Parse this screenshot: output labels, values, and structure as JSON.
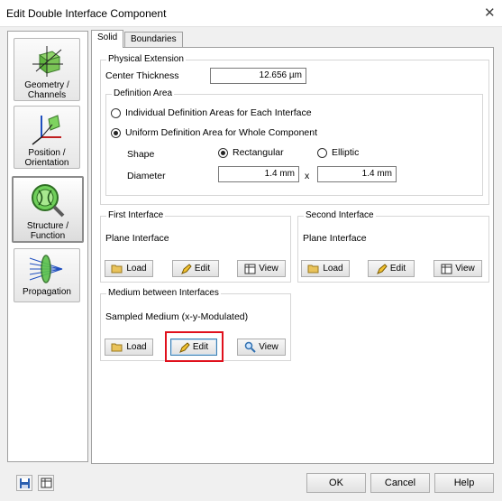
{
  "window": {
    "title": "Edit Double Interface Component",
    "close_glyph": "✕"
  },
  "sidebar": {
    "items": [
      {
        "label": "Geometry / Channels",
        "icon": "geometry-cube-icon"
      },
      {
        "label": "Position / Orientation",
        "icon": "axes-icon"
      },
      {
        "label": "Structure / Function",
        "icon": "lens-magnifier-icon",
        "selected": true
      },
      {
        "label": "Propagation",
        "icon": "propagation-lens-icon"
      }
    ]
  },
  "tabs": [
    {
      "label": "Solid",
      "active": true
    },
    {
      "label": "Boundaries",
      "active": false
    }
  ],
  "physical_extension": {
    "group_label": "Physical Extension",
    "center_thickness_label": "Center Thickness",
    "center_thickness_value": "12.656 µm",
    "definition_area": {
      "group_label": "Definition Area",
      "option_individual": "Individual Definition Areas for Each Interface",
      "option_uniform": "Uniform Definition Area for Whole Component",
      "selected": "uniform",
      "shape_label": "Shape",
      "shape_rect": "Rectangular",
      "shape_elliptic": "Elliptic",
      "shape_selected": "rectangular",
      "diameter_label": "Diameter",
      "diameter_x": "1.4 mm",
      "times": "x",
      "diameter_y": "1.4 mm"
    }
  },
  "first_interface": {
    "group_label": "First Interface",
    "type": "Plane Interface",
    "load": "Load",
    "edit": "Edit",
    "view": "View"
  },
  "second_interface": {
    "group_label": "Second Interface",
    "type": "Plane Interface",
    "load": "Load",
    "edit": "Edit",
    "view": "View"
  },
  "medium": {
    "group_label": "Medium between Interfaces",
    "type": "Sampled Medium (x-y-Modulated)",
    "load": "Load",
    "edit": "Edit",
    "view": "View"
  },
  "footer": {
    "ok": "OK",
    "cancel": "Cancel",
    "help": "Help"
  },
  "colors": {
    "highlight": "#e0101c",
    "accent_green": "#3fa648",
    "selection_blue": "#3c7fb1"
  }
}
